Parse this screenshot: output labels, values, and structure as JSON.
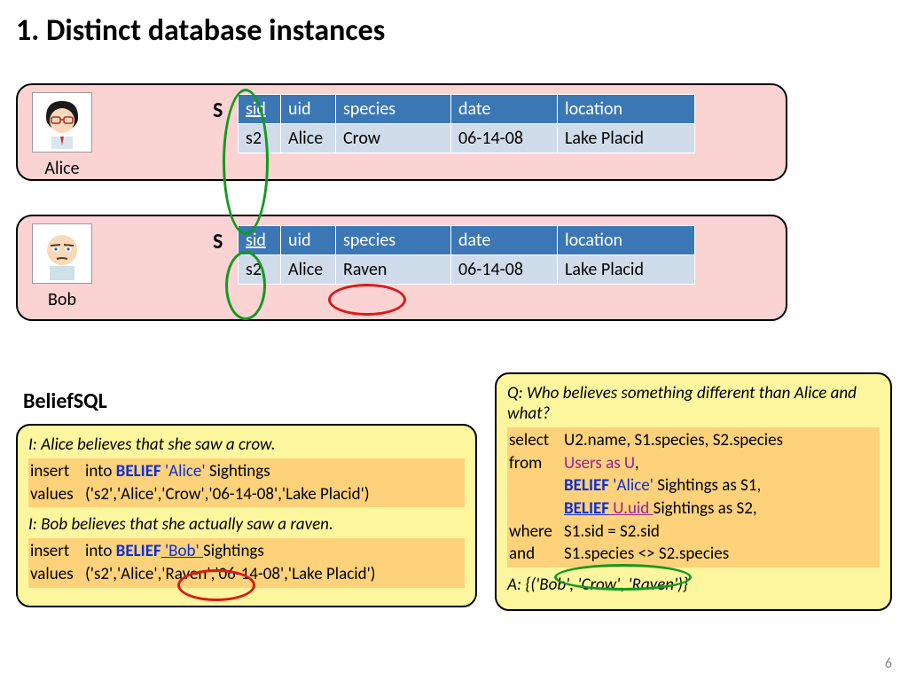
{
  "title": "1. Distinct database instances",
  "page_number": "6",
  "users": {
    "alice": {
      "name": "Alice",
      "table_label": "S"
    },
    "bob": {
      "name": "Bob",
      "table_label": "S"
    }
  },
  "table": {
    "headers": {
      "sid": "sid",
      "uid": "uid",
      "species": "species",
      "date": "date",
      "location": "location"
    },
    "alice_row": {
      "sid": "s2",
      "uid": "Alice",
      "species": "Crow",
      "date": "06-14-08",
      "location": "Lake Placid"
    },
    "bob_row": {
      "sid": "s2",
      "uid": "Alice",
      "species": "Raven",
      "date": "06-14-08",
      "location": "Lake Placid"
    }
  },
  "beliefsql_heading": "BeliefSQL",
  "left_box": {
    "desc1": "I: Alice believes that she saw a crow.",
    "ins1_kw1": "insert",
    "ins1_rest1": "into ",
    "ins1_belief": "BELIEF",
    "ins1_name": " 'Alice' ",
    "ins1_tbl": "Sightings",
    "ins1_kw2": "values",
    "ins1_vals": "('s2','Alice','Crow','06-14-08','Lake Placid')",
    "desc2": "I: Bob believes that she actually saw a raven.",
    "ins2_kw1": "insert",
    "ins2_rest1": "into ",
    "ins2_belief": "BELIEF",
    "ins2_name": " 'Bob' ",
    "ins2_tbl": "Sightings",
    "ins2_kw2": "values",
    "ins2_vals": "('s2','Alice','Raven','06-14-08','Lake Placid')"
  },
  "right_box": {
    "question": "Q: Who believes something different than Alice and what?",
    "sel_kw": "select",
    "sel_cols": "U2.name, S1.species, S2.species",
    "from_kw": "from",
    "from_l1a": "Users as U",
    "from_l1b": ",",
    "from_l2a": "BELIEF",
    "from_l2b": " 'Alice' ",
    "from_l2c": "Sightings as S1,",
    "from_l3a": "BELIEF",
    "from_l3b": " U.uid ",
    "from_l3c": "Sightings as S2,",
    "where_kw": "where",
    "where_cond": "S1.sid = S2.sid",
    "and_kw": "and",
    "and_cond": "S1.species <> S2.species",
    "answer": "A: {('Bob', 'Crow', 'Raven')}"
  }
}
